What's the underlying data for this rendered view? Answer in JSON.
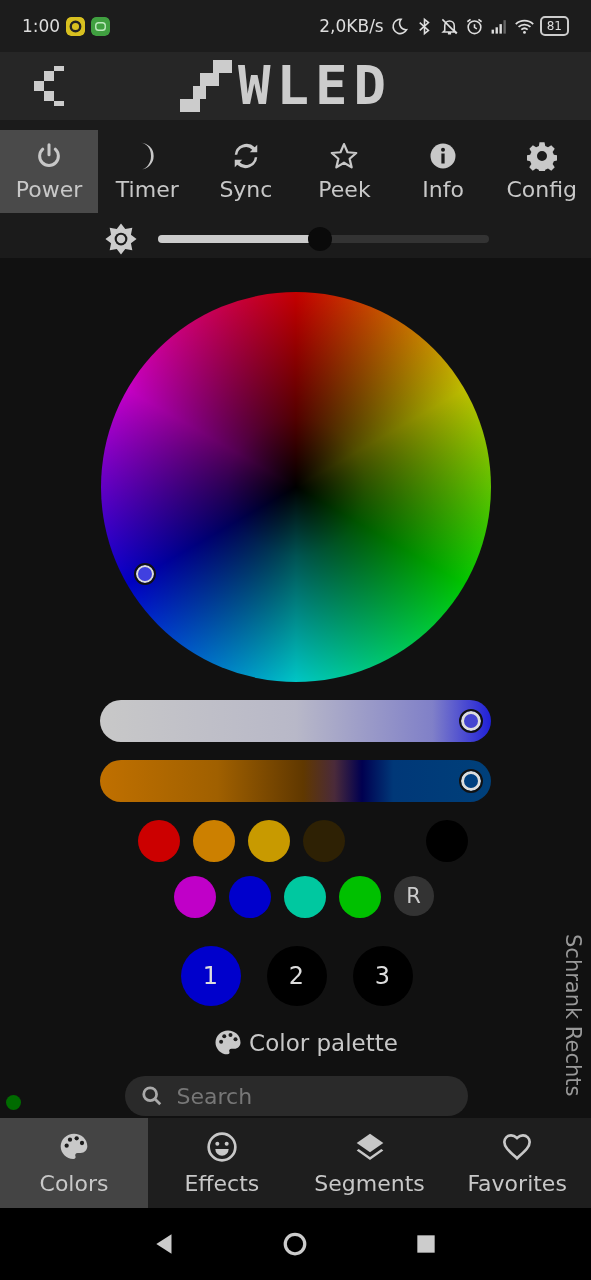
{
  "status_bar": {
    "time": "1:00",
    "net_speed": "2,0KB/s",
    "battery": "81"
  },
  "header": {
    "logo": "WLED"
  },
  "top_tabs": [
    {
      "label": "Power",
      "selected": true
    },
    {
      "label": "Timer",
      "selected": false
    },
    {
      "label": "Sync",
      "selected": false
    },
    {
      "label": "Peek",
      "selected": false
    },
    {
      "label": "Info",
      "selected": false
    },
    {
      "label": "Config",
      "selected": false
    }
  ],
  "brightness": {
    "level": 0.49
  },
  "sliders": [
    {
      "kind": "saturation",
      "level": 0.95
    },
    {
      "kind": "temperature",
      "level": 0.95
    }
  ],
  "quick_colors": [
    [
      {
        "color": "#cc0000"
      },
      {
        "color": "#cc8000"
      },
      {
        "color": "#c89a00"
      },
      {
        "color": "#2e2104"
      },
      {
        "color": "#000000"
      }
    ],
    [
      {
        "color": "#c000c8"
      },
      {
        "color": "#0000cc"
      },
      {
        "color": "#00c8a0"
      },
      {
        "color": "#00c000"
      },
      {
        "label": "R"
      }
    ]
  ],
  "color_slots": [
    {
      "label": "1",
      "selected": true
    },
    {
      "label": "2",
      "selected": false
    },
    {
      "label": "3",
      "selected": false
    }
  ],
  "palette_heading": "Color palette",
  "search": {
    "placeholder": "Search"
  },
  "connection": {
    "color": "#006b00"
  },
  "device_name": "Schrank Rechts",
  "bottom_tabs": [
    {
      "label": "Colors",
      "selected": true
    },
    {
      "label": "Effects",
      "selected": false
    },
    {
      "label": "Segments",
      "selected": false
    },
    {
      "label": "Favorites",
      "selected": false
    }
  ]
}
